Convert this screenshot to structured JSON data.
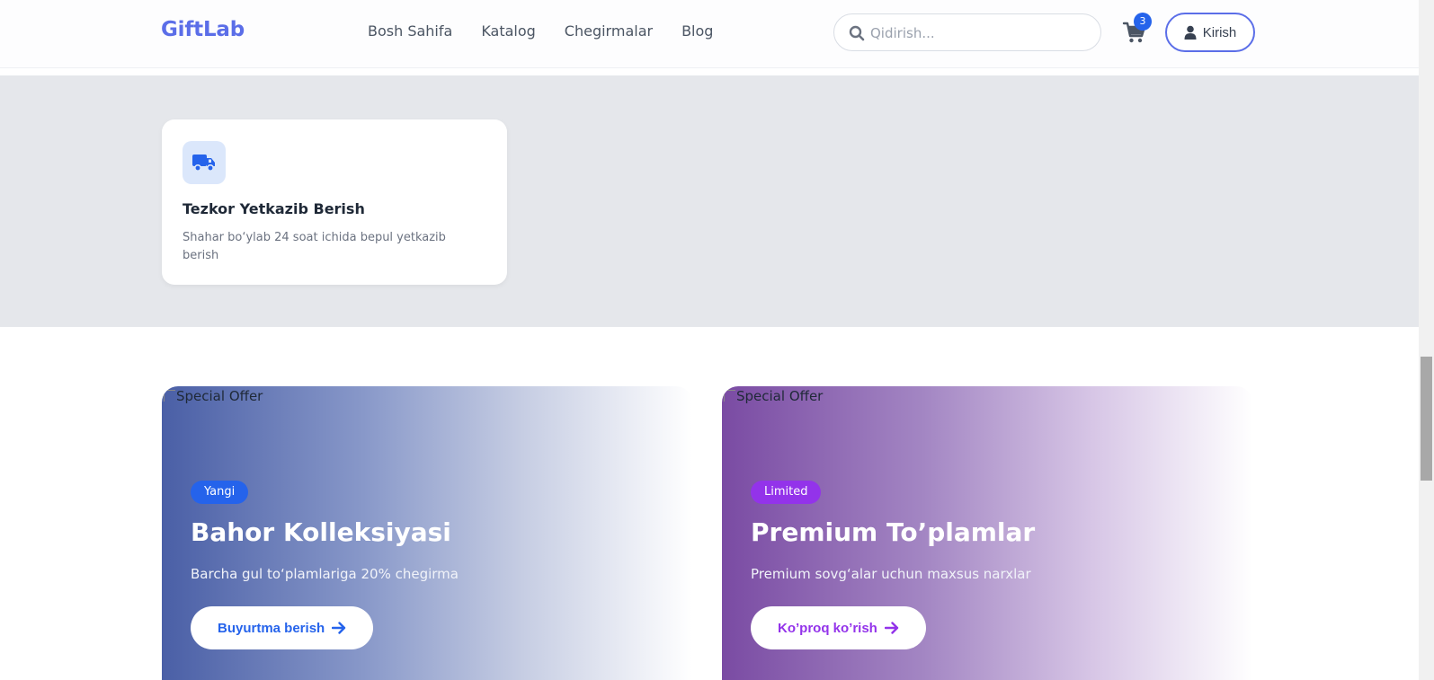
{
  "header": {
    "logo": "GiftLab",
    "nav": [
      "Bosh Sahifa",
      "Katalog",
      "Chegirmalar",
      "Blog"
    ],
    "search_placeholder": "Qidirish...",
    "cart_count": "3",
    "login_label": "Kirish"
  },
  "feature": {
    "icon": "truck-icon",
    "title": "Tezkor Yetkazib Berish",
    "description": "Shahar bo‘ylab 24 soat ichida bepul yetkazib berish"
  },
  "promos": [
    {
      "img_alt": "Special Offer",
      "tag": "Yangi",
      "title": "Bahor Kolleksiyasi",
      "subtitle": "Barcha gul to‘plamlariga 20% chegirma",
      "cta": "Buyurtma berish",
      "accent": "#2563eb"
    },
    {
      "img_alt": "Special Offer",
      "tag": "Limited",
      "title": "Premium To’plamlar",
      "subtitle": "Premium sovg‘alar uchun maxsus narxlar",
      "cta": "Ko’proq ko’rish",
      "accent": "#9333ea"
    }
  ],
  "colors": {
    "brand": "#5b6ee8",
    "band": "#e5e7eb"
  }
}
